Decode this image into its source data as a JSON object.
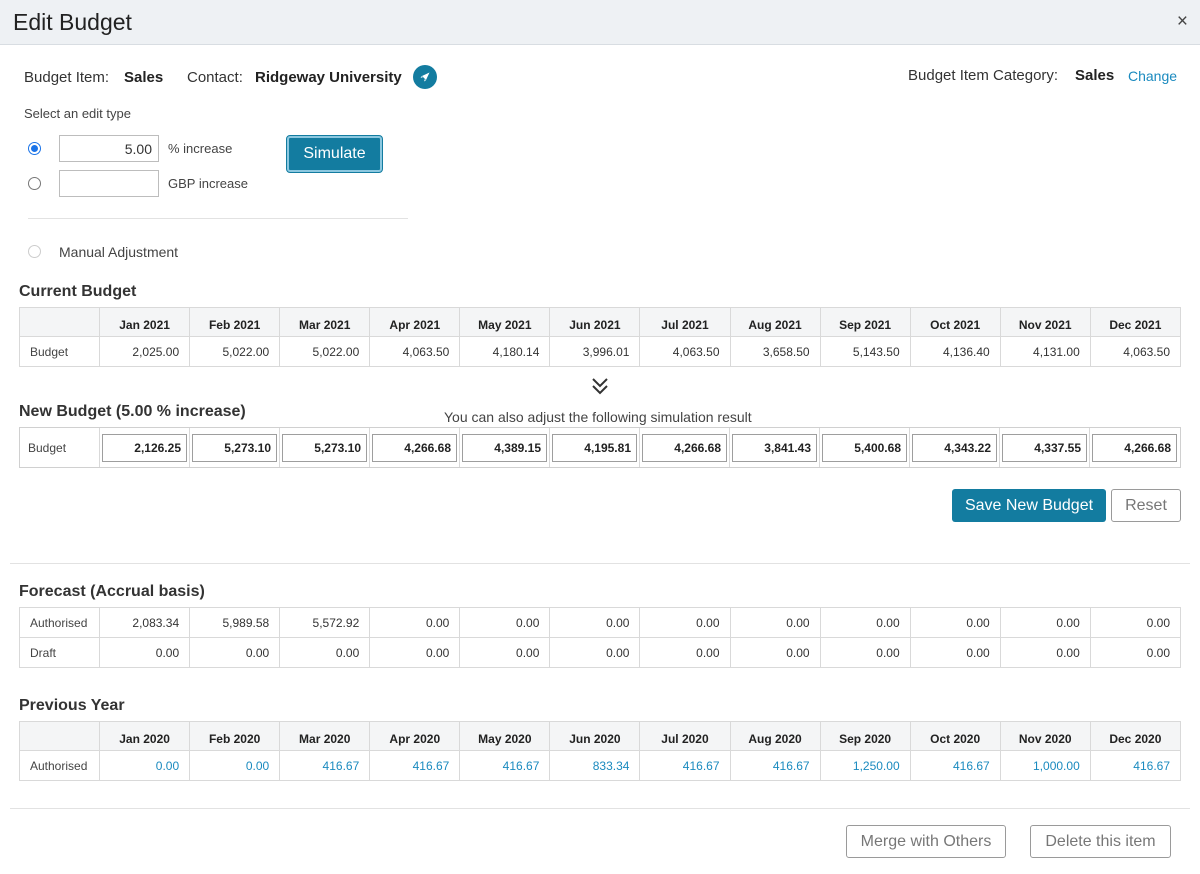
{
  "header": {
    "title": "Edit Budget",
    "close_glyph": "×"
  },
  "budget_item": {
    "label": "Budget Item:",
    "value": "Sales"
  },
  "contact": {
    "label": "Contact:",
    "value": "Ridgeway University"
  },
  "category": {
    "label": "Budget Item Category:",
    "value": "Sales",
    "change_link": "Change"
  },
  "edit_type": {
    "prompt": "Select an edit type",
    "percent": {
      "value": "5.00",
      "label": "% increase",
      "selected": true
    },
    "gbp": {
      "value": "",
      "label": "GBP  increase",
      "selected": false
    },
    "manual": {
      "label": "Manual Adjustment",
      "selected": false
    }
  },
  "simulate_button": "Simulate",
  "current_budget": {
    "title": "Current Budget",
    "months": [
      "Jan 2021",
      "Feb 2021",
      "Mar 2021",
      "Apr 2021",
      "May 2021",
      "Jun 2021",
      "Jul 2021",
      "Aug 2021",
      "Sep 2021",
      "Oct 2021",
      "Nov 2021",
      "Dec 2021"
    ],
    "row_label": "Budget",
    "values": [
      "2,025.00",
      "5,022.00",
      "5,022.00",
      "4,063.50",
      "4,180.14",
      "3,996.01",
      "4,063.50",
      "3,658.50",
      "5,143.50",
      "4,136.40",
      "4,131.00",
      "4,063.50"
    ]
  },
  "new_budget": {
    "title": "New Budget (5.00 % increase)",
    "hint": "You can also adjust the following simulation result",
    "row_label": "Budget",
    "values": [
      "2,126.25",
      "5,273.10",
      "5,273.10",
      "4,266.68",
      "4,389.15",
      "4,195.81",
      "4,266.68",
      "3,841.43",
      "5,400.68",
      "4,343.22",
      "4,337.55",
      "4,266.68"
    ]
  },
  "actions": {
    "save": "Save New Budget",
    "reset": "Reset"
  },
  "forecast": {
    "title": "Forecast (Accrual basis)",
    "rows": [
      {
        "label": "Authorised",
        "values": [
          "2,083.34",
          "5,989.58",
          "5,572.92",
          "0.00",
          "0.00",
          "0.00",
          "0.00",
          "0.00",
          "0.00",
          "0.00",
          "0.00",
          "0.00"
        ]
      },
      {
        "label": "Draft",
        "values": [
          "0.00",
          "0.00",
          "0.00",
          "0.00",
          "0.00",
          "0.00",
          "0.00",
          "0.00",
          "0.00",
          "0.00",
          "0.00",
          "0.00"
        ]
      }
    ]
  },
  "previous_year": {
    "title": "Previous Year",
    "months": [
      "Jan 2020",
      "Feb 2020",
      "Mar 2020",
      "Apr 2020",
      "May 2020",
      "Jun 2020",
      "Jul 2020",
      "Aug 2020",
      "Sep 2020",
      "Oct 2020",
      "Nov 2020",
      "Dec 2020"
    ],
    "row_label": "Authorised",
    "values": [
      "0.00",
      "0.00",
      "416.67",
      "416.67",
      "416.67",
      "833.34",
      "416.67",
      "416.67",
      "1,250.00",
      "416.67",
      "1,000.00",
      "416.67"
    ]
  },
  "footer": {
    "merge": "Merge with Others",
    "delete": "Delete this item"
  },
  "colors": {
    "accent": "#137ca0",
    "link": "#1a8abf",
    "header_bg": "#eef1f4"
  }
}
